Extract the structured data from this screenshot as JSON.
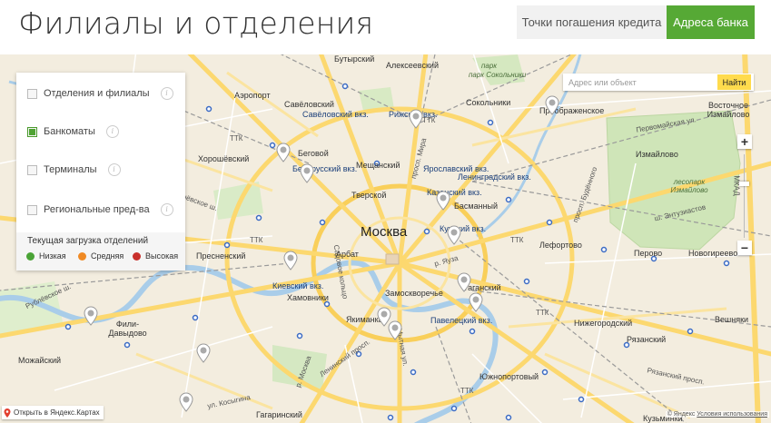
{
  "header": {
    "title": "Филиалы и отделения",
    "loan_button": "Точки погашения кредита",
    "address_button": "Адреса банка"
  },
  "filters": {
    "items": [
      {
        "label": "Отделения и филиалы",
        "checked": false
      },
      {
        "label": "Банкоматы",
        "checked": true
      },
      {
        "label": "Терминалы",
        "checked": false
      },
      {
        "label": "Региональные пред-ва",
        "checked": false
      }
    ],
    "info_glyph": "i",
    "load_title": "Текущая загрузка отделений",
    "load_levels": [
      {
        "label": "Низкая",
        "color": "#4aa336"
      },
      {
        "label": "Средняя",
        "color": "#f08a24"
      },
      {
        "label": "Высокая",
        "color": "#c9302c"
      }
    ]
  },
  "search": {
    "placeholder": "Адрес или объект",
    "button": "Найти"
  },
  "zoom": {
    "plus": "+",
    "minus": "−"
  },
  "map": {
    "city": "Москва",
    "districts": [
      "Бутырский",
      "Алексеевский",
      "Аэропорт",
      "Савёловский",
      "Рижская",
      "Сокольники",
      "Преображенское",
      "Восточное Измайлово",
      "Хорошёвский",
      "Беговой",
      "Мещанский",
      "Измайлово",
      "Тверской",
      "Басманный",
      "Пресненский",
      "Арбат",
      "Лефортово",
      "Перово",
      "Новогиреево",
      "Хамовники",
      "Якиманка",
      "Замоскворечье",
      "Таганский",
      "Нижегородский",
      "Вешняки",
      "Фили-Давыдово",
      "Можайский",
      "Рязанский",
      "Южнопортовый",
      "Гагаринский",
      "Кузьминки"
    ],
    "stations": [
      "Савёловский вкз.",
      "Рижский вкз.",
      "Белорусский вкз.",
      "Ярославский вкз.",
      "Ленинградский вкз.",
      "Казанский вкз.",
      "Курский вкз.",
      "Киевский вкз.",
      "Павелецкий вкз."
    ],
    "streets": [
      "ТТК",
      "Хорошёвское ш.",
      "просп. Мира",
      "Первомайская ул.",
      "ш. Энтузиастов",
      "Ленинский просп.",
      "Рязанский просп.",
      "ул. Косыгина",
      "Рублёвское ш.",
      "Садовое кольцо",
      "Кутузовский просп.",
      "просп. Будённого",
      "МКАД",
      "р. Яуза",
      "р. Москва",
      "ул. Вавилова",
      "Мытная ул."
    ],
    "parks": [
      "парк Сокольники",
      "лесопарк Измайлово",
      "парк"
    ],
    "marker_count": 14
  },
  "bottom": {
    "open_yandex": "Открыть в Яндекс.Картах",
    "copyright": "© Яндекс",
    "terms": "Условия использования"
  }
}
